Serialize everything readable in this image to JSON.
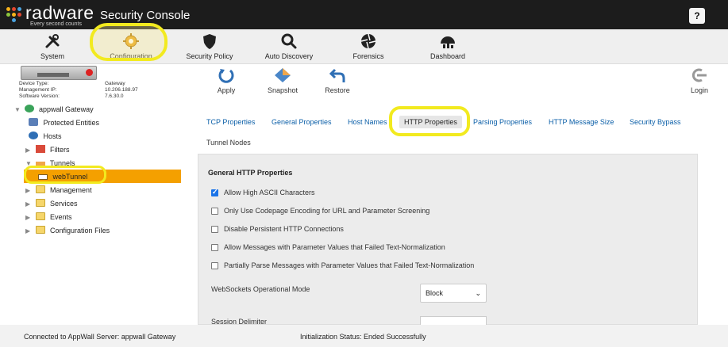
{
  "header": {
    "brand": "radware",
    "tagline": "Every second counts",
    "app_title": "Security Console",
    "help_label": "?"
  },
  "nav": [
    {
      "label": "System",
      "icon": "tools-icon"
    },
    {
      "label": "Configuration",
      "icon": "gear-icon"
    },
    {
      "label": "Security Policy",
      "icon": "shield-icon"
    },
    {
      "label": "Auto Discovery",
      "icon": "search-icon"
    },
    {
      "label": "Forensics",
      "icon": "aperture-icon"
    },
    {
      "label": "Dashboard",
      "icon": "dashboard-icon"
    }
  ],
  "device": {
    "type_label": "Device Type:",
    "type_value": "Gateway",
    "ip_label": "Management IP:",
    "ip_value": "10.206.188.97",
    "version_label": "Software Version:",
    "version_value": "7.6.30.0"
  },
  "actions": {
    "apply": "Apply",
    "snapshot": "Snapshot",
    "restore": "Restore",
    "login": "Login"
  },
  "tree": {
    "root": "appwall Gateway",
    "protected": "Protected Entities",
    "hosts": "Hosts",
    "filters": "Filters",
    "tunnels": "Tunnels",
    "webtunnel": "webTunnel",
    "management": "Management",
    "services": "Services",
    "events": "Events",
    "config_files": "Configuration Files"
  },
  "tabs": [
    "TCP Properties",
    "General Properties",
    "Host Names",
    "HTTP Properties",
    "Parsing Properties",
    "HTTP Message Size",
    "Security Bypass",
    "Tunnel Nodes"
  ],
  "active_tab": "HTTP Properties",
  "panel": {
    "title": "General HTTP Properties",
    "options": [
      {
        "label": "Allow High ASCII Characters",
        "checked": true
      },
      {
        "label": "Only Use Codepage Encoding for URL and Parameter Screening",
        "checked": false
      },
      {
        "label": "Disable Persistent HTTP Connections",
        "checked": false
      },
      {
        "label": "Allow Messages with Parameter Values that Failed Text-Normalization",
        "checked": false
      },
      {
        "label": "Partially Parse Messages with Parameter Values that Failed Text-Normalization",
        "checked": false
      }
    ],
    "websocket_label": "WebSockets Operational Mode",
    "websocket_value": "Block",
    "session_label": "Session Delimiter"
  },
  "status": {
    "connected": "Connected to AppWall Server: appwall Gateway",
    "init": "Initialization Status: Ended Successfully"
  },
  "colors": {
    "header_bg": "#1c1c1c",
    "selection": "#f4a000",
    "highlight": "#f2ea1f",
    "link": "#0b5fa8"
  }
}
